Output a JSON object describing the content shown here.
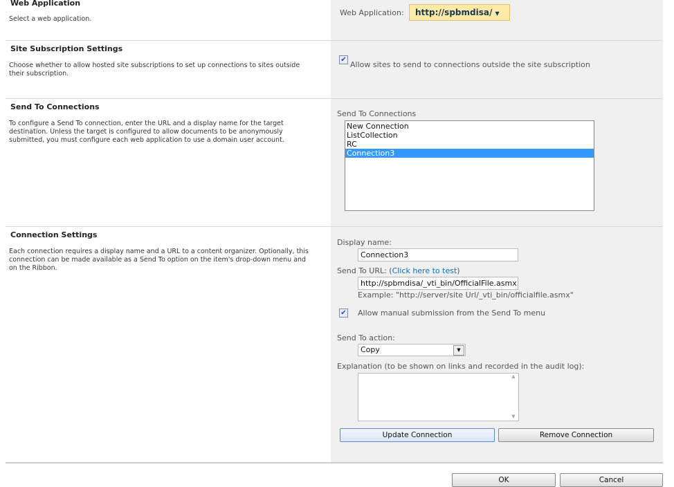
{
  "web_app": {
    "title": "Web Application",
    "desc": "Select a web application.",
    "label": "Web Application:",
    "value": "http://spbmdisa/"
  },
  "subscription": {
    "title": "Site Subscription Settings",
    "desc": "Choose whether to allow hosted site subscriptions to set up connections to sites outside their subscription.",
    "checkbox_label": "Allow sites to send to connections outside the site subscription",
    "checked": true
  },
  "send_to": {
    "title": "Send To Connections",
    "desc": "To configure a Send To connection, enter the URL and a display name for the target destination. Unless the target is configured to allow documents to be anonymously submitted, you must configure each web application to use a domain user account.",
    "list_label": "Send To Connections",
    "items": [
      "New Connection",
      "ListCollection",
      "RC",
      "Connection3"
    ],
    "selected": "Connection3"
  },
  "connection": {
    "title": "Connection Settings",
    "desc": "Each connection requires a display name and a URL to a content organizer. Optionally, this connection can be made available as a Send To option on the item's drop-down menu and on the Ribbon.",
    "display_name_label": "Display name:",
    "display_name": "Connection3",
    "url_label": "Send To URL: (",
    "test_link": "Click here to test",
    "url_label_end": ")",
    "url": "http://spbmdisa/_vti_bin/OfficialFile.asmx",
    "example": "Example: \"http://server/site Url/_vti_bin/officialfile.asmx\"",
    "manual_label": "Allow manual submission from the Send To menu",
    "manual_checked": true,
    "action_label": "Send To action:",
    "action": "Copy",
    "explanation_label": "Explanation (to be shown on links and recorded in the audit log):",
    "explanation": "",
    "update_button": "Update Connection",
    "remove_button": "Remove Connection"
  },
  "footer": {
    "ok": "OK",
    "cancel": "Cancel"
  },
  "colors": {
    "selected": "#3399ff",
    "link": "#0072bc",
    "dropdown": "#fde9a8"
  }
}
